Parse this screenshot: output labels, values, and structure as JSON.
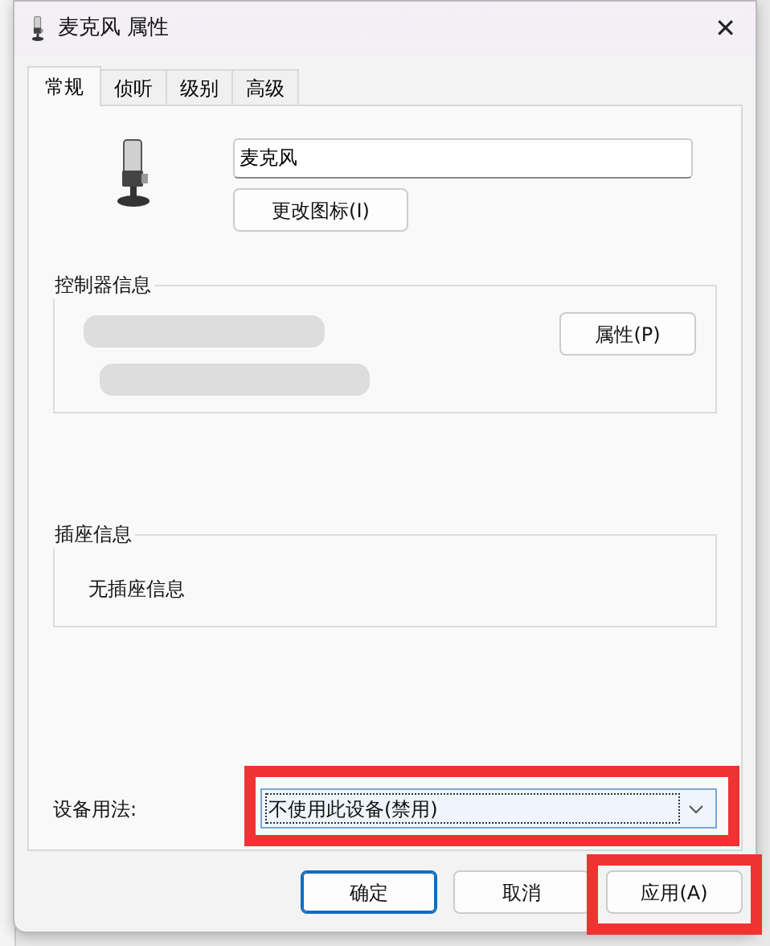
{
  "window": {
    "title": "麦克风 属性",
    "close": "✕"
  },
  "tabs": [
    {
      "label": "常规",
      "selected": true
    },
    {
      "label": "侦听",
      "selected": false
    },
    {
      "label": "级别",
      "selected": false
    },
    {
      "label": "高级",
      "selected": false
    }
  ],
  "device_name": {
    "value": "麦克风"
  },
  "change_icon_button": {
    "label": "更改图标(I)"
  },
  "controller_group": {
    "title": "控制器信息",
    "button": "属性(P)",
    "redacted": true
  },
  "jack_group": {
    "title": "插座信息",
    "text": "无插座信息"
  },
  "usage": {
    "label": "设备用法:",
    "value": "不使用此设备(禁用)",
    "highlighted": true
  },
  "buttons": [
    {
      "label": "确定",
      "default": true,
      "highlighted": false
    },
    {
      "label": "取消",
      "default": false,
      "highlighted": false
    },
    {
      "label": "应用(A)",
      "default": false,
      "highlighted": true
    }
  ]
}
